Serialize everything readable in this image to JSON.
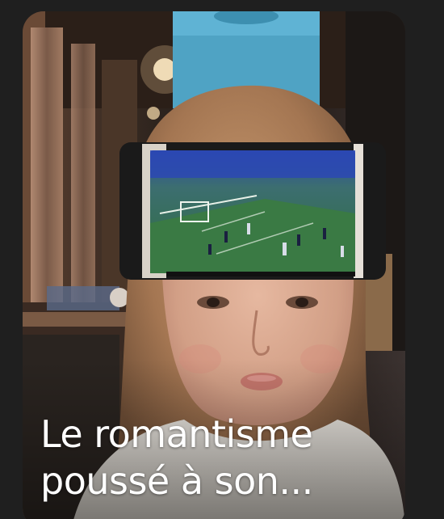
{
  "story": {
    "caption_line1": "Le romantisme",
    "caption_line2": "poussé à son...",
    "thumbnail_icon": "photo-thumbnail"
  },
  "colors": {
    "background": "#1f1f1f",
    "caption_text": "#ffffff",
    "banner": "#4fa3c4",
    "pitch": "#2f6e3a"
  }
}
